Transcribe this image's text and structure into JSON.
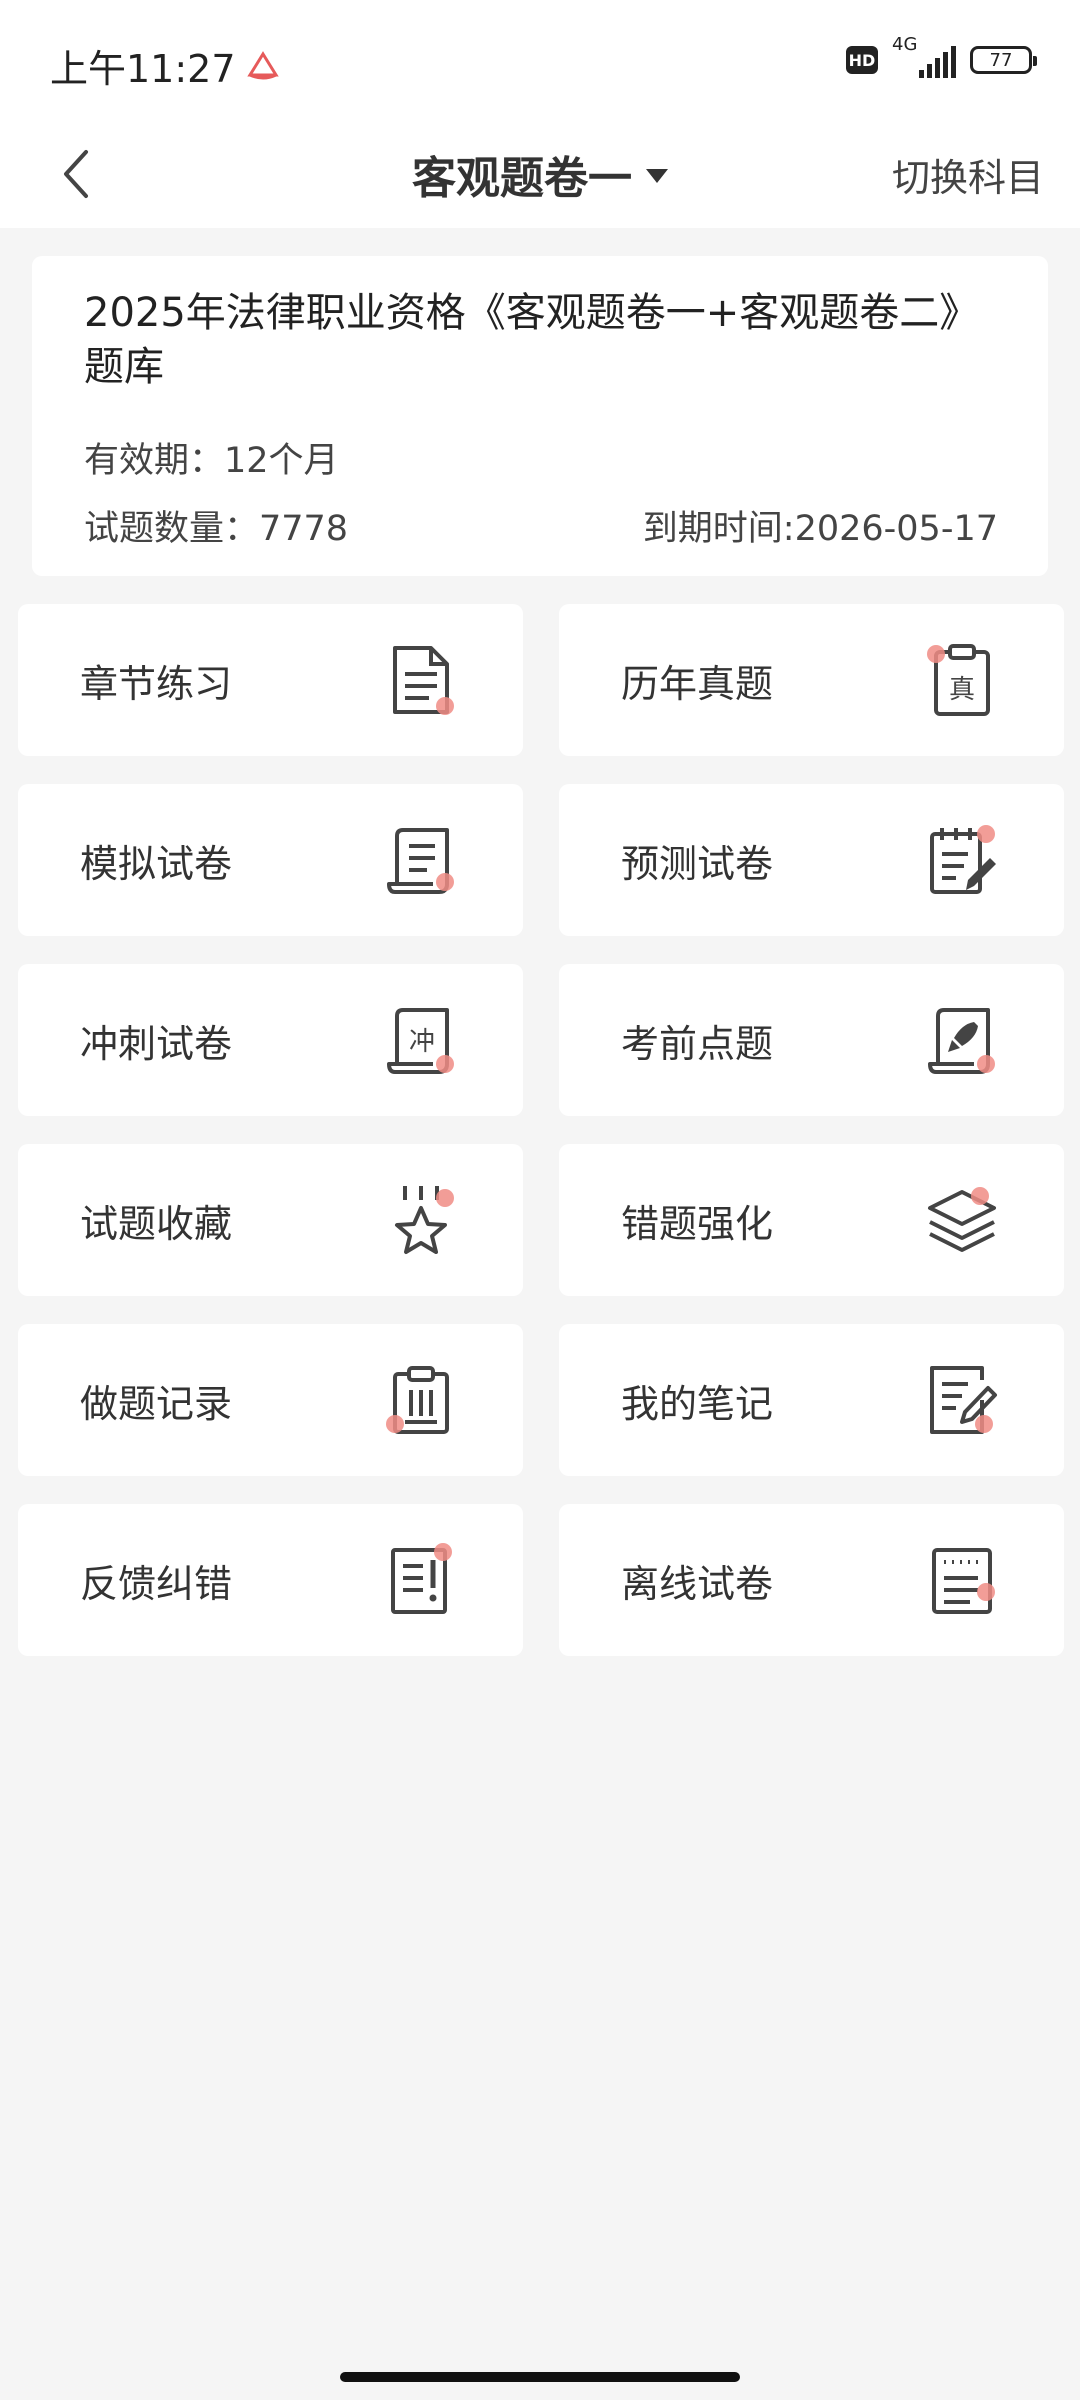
{
  "status_bar": {
    "time": "上午11:27",
    "hd": "HD",
    "network": "4G",
    "battery": "77"
  },
  "nav": {
    "title": "客观题卷一",
    "switch_label": "切换科目"
  },
  "info": {
    "title": "2025年法律职业资格《客观题卷一+客观题卷二》题库",
    "validity": "有效期：12个月",
    "count": "试题数量：7778",
    "expiry": "到期时间:2026-05-17"
  },
  "accent_color": "#f08c85",
  "icon_color": "#444444",
  "tiles": [
    {
      "label": "章节练习",
      "icon": "document-icon"
    },
    {
      "label": "历年真题",
      "icon": "clipboard-zhen-icon"
    },
    {
      "label": "模拟试卷",
      "icon": "scroll-icon"
    },
    {
      "label": "预测试卷",
      "icon": "notepad-pencil-icon"
    },
    {
      "label": "冲刺试卷",
      "icon": "scroll-chong-icon"
    },
    {
      "label": "考前点题",
      "icon": "rocket-scroll-icon"
    },
    {
      "label": "试题收藏",
      "icon": "star-icon"
    },
    {
      "label": "错题强化",
      "icon": "layers-icon"
    },
    {
      "label": "做题记录",
      "icon": "clipboard-list-icon"
    },
    {
      "label": "我的笔记",
      "icon": "note-pen-icon"
    },
    {
      "label": "反馈纠错",
      "icon": "feedback-icon"
    },
    {
      "label": "离线试卷",
      "icon": "offline-paper-icon"
    }
  ]
}
